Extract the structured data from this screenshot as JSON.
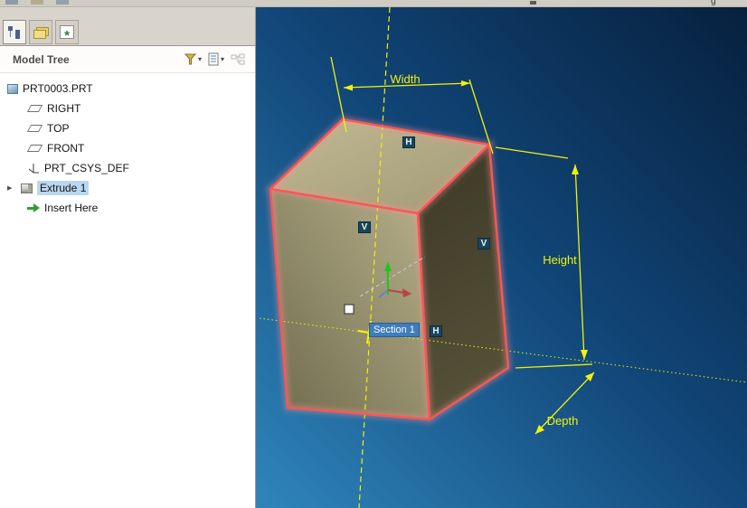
{
  "icons": {
    "expand_triangle": "▶",
    "dropdown_caret": "▾",
    "asterisk": "*"
  },
  "top_strip": {
    "fragment": "g"
  },
  "sidebar": {
    "header": {
      "title": "Model Tree"
    },
    "tree": [
      {
        "label": "PRT0003.PRT"
      },
      {
        "label": "RIGHT"
      },
      {
        "label": "TOP"
      },
      {
        "label": "FRONT"
      },
      {
        "label": "PRT_CSYS_DEF"
      },
      {
        "label": "Extrude 1"
      },
      {
        "label": "Insert Here"
      }
    ]
  },
  "viewport": {
    "dimension_labels": {
      "width": "Width",
      "height": "Height",
      "depth": "Depth"
    },
    "section_label": "Section 1",
    "badges": {
      "top_h": "H",
      "front_v": "V",
      "right_v": "V",
      "bottom_h": "H"
    },
    "colors": {
      "edge_highlight": "#ff5555",
      "annotation_yellow": "#f2f20a",
      "face_tan": "#b8b08b",
      "face_dark": "#3b3826",
      "selection_blue": "#b9d7ef",
      "section_bg": "#3f7dbd",
      "background_top": "#07203e",
      "background_bottom": "#2f85bb"
    }
  }
}
